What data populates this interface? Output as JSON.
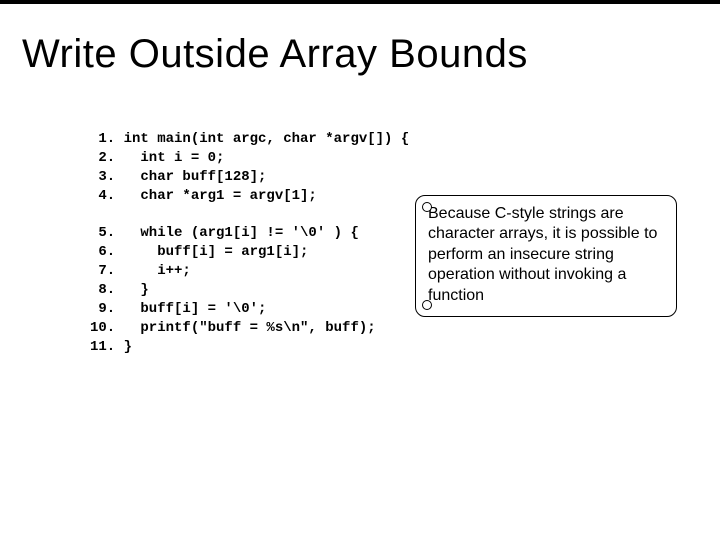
{
  "title": "Write Outside Array Bounds",
  "code": {
    "l1": " 1. int main(int argc, char *argv[]) {",
    "l2": " 2.   int i = 0;",
    "l3": " 3.   char buff[128];",
    "l4": " 4.   char *arg1 = argv[1];",
    "blank1": "",
    "l5": " 5.   while (arg1[i] != '\\0' ) {",
    "l6": " 6.     buff[i] = arg1[i];",
    "l7": " 7.     i++;",
    "l8": " 8.   }",
    "l9": " 9.   buff[i] = '\\0';",
    "l10": "10.   printf(\"buff = %s\\n\", buff);",
    "l11": "11. }"
  },
  "callout": {
    "text": "Because C-style strings are character arrays, it is possible to perform an insecure string operation without invoking a function"
  }
}
